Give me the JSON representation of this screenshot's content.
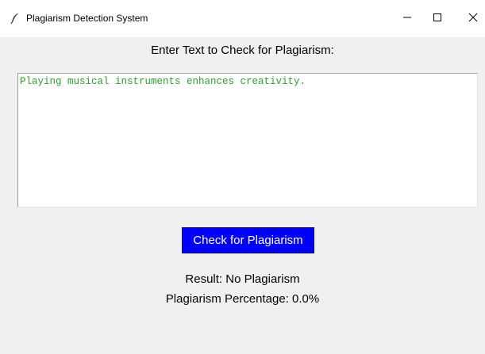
{
  "window": {
    "title": "Plagiarism Detection System",
    "icon": "feather-icon",
    "controls": {
      "minimize_icon": "minimize-icon",
      "maximize_icon": "maximize-icon",
      "close_icon": "close-icon"
    }
  },
  "main": {
    "prompt_label": "Enter Text to Check for Plagiarism:",
    "input_text": "Playing musical instruments enhances creativity.",
    "check_button_label": "Check for Plagiarism",
    "result_text": "Result: No Plagiarism",
    "percentage_text": "Plagiarism Percentage: 0.0%"
  },
  "colors": {
    "background": "#f0f0f0",
    "button_bg": "#0000ff",
    "button_text": "#ffffff",
    "input_text": "#2e9e2e"
  }
}
